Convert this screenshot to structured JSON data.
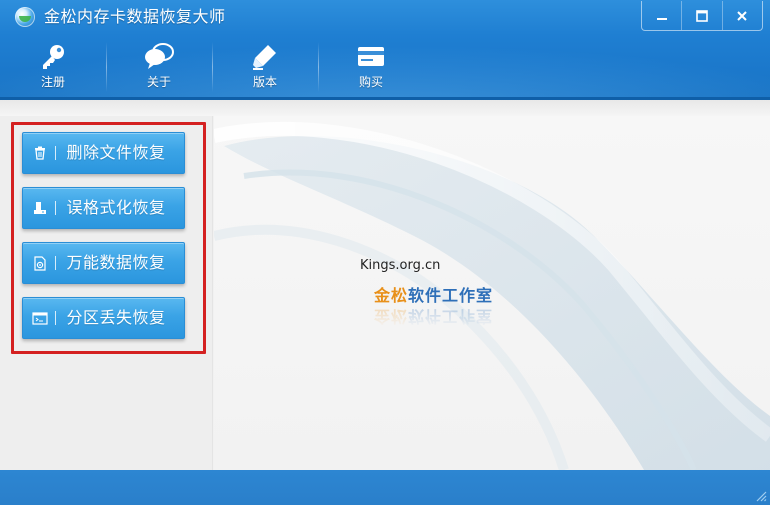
{
  "window": {
    "title": "金松内存卡数据恢复大师"
  },
  "window_controls": {
    "minimize_icon": "minimize-icon",
    "maximize_icon": "maximize-icon",
    "close_icon": "close-icon"
  },
  "toolbar": {
    "items": [
      {
        "label": "注册",
        "icon": "key-icon"
      },
      {
        "label": "关于",
        "icon": "chat-bubbles-icon"
      },
      {
        "label": "版本",
        "icon": "pen-icon"
      },
      {
        "label": "购买",
        "icon": "card-icon"
      }
    ]
  },
  "functions": [
    {
      "label": "删除文件恢复",
      "icon": "trash-icon"
    },
    {
      "label": "误格式化恢复",
      "icon": "format-disk-icon"
    },
    {
      "label": "万能数据恢复",
      "icon": "document-gear-icon"
    },
    {
      "label": "分区丢失恢复",
      "icon": "terminal-window-icon"
    }
  ],
  "branding": {
    "site": "Kings.org.cn",
    "studio_part1": "金松",
    "studio_part2": "软件工作室"
  },
  "colors": {
    "accent_blue": "#1f7fd2",
    "button_blue": "#3aa3e6",
    "highlight_red": "#d42121",
    "brand_gold": "#e8901a",
    "brand_blue": "#2e6fb8"
  }
}
